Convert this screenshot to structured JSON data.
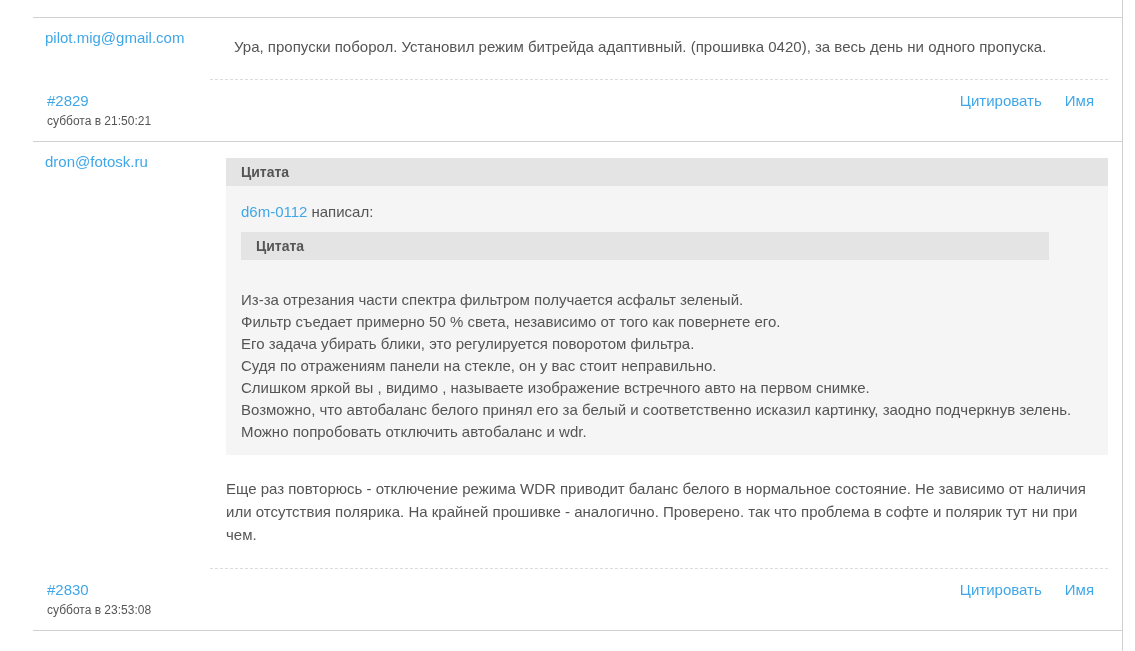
{
  "posts": [
    {
      "author": "pilot.mig@gmail.com",
      "text": "Ура, пропуски поборол. Установил режим битрейда адаптивный. (прошивка 0420), за весь день ни одного пропуска.",
      "number": "#2829",
      "date": "суббота в 21:50:21",
      "actions": [
        "Цитировать",
        "Имя"
      ]
    },
    {
      "author": "dron@fotosk.ru",
      "quote": {
        "title": "Цитата",
        "quoted_author": "d6m-0112",
        "wrote": "написал:",
        "inner_quote": {
          "title": "Цитата"
        },
        "lines": [
          "Из-за отрезания части спектра фильтром получается асфальт зеленый.",
          "Фильтр съедает примерно 50 % света, независимо от того как повернете его.",
          "Его задача убирать блики, это регулируется поворотом фильтра.",
          "Судя по отражениям панели на стекле, он у вас стоит неправильно.",
          "Слишком яркой вы , видимо , называете изображение встречного авто на первом снимке.",
          "Возможно, что автобаланс белого принял его за белый и соответственно исказил картинку, заодно подчеркнув зелень.",
          "Можно попробовать отключить автобаланс и wdr."
        ]
      },
      "text": "Еще раз повторюсь - отключение режима WDR приводит баланс белого в нормальное состояние. Не зависимо от наличия или отсутствия полярика. На крайней прошивке - аналогично. Проверено. так что проблема в софте и полярик тут ни при чем.",
      "number": "#2830",
      "date": "суббота в 23:53:08",
      "actions": [
        "Цитировать",
        "Имя"
      ]
    }
  ]
}
